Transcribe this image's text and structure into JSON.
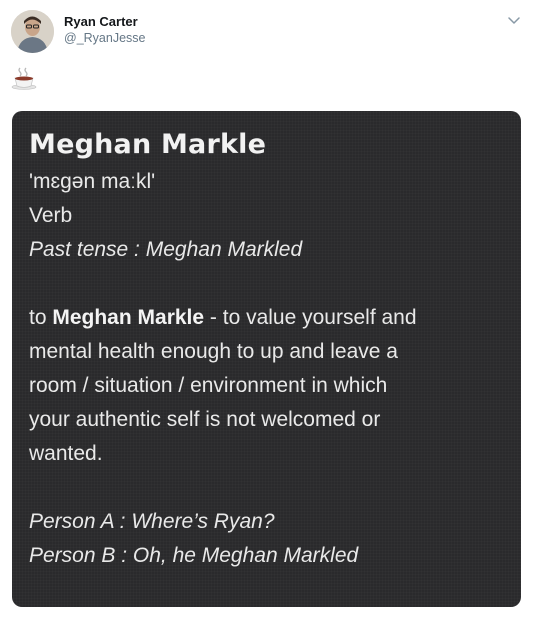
{
  "user": {
    "display_name": "Ryan Carter",
    "handle": "@_RyanJesse"
  },
  "icons": {
    "menu": "chevron-down-icon",
    "emoji": "hot-beverage-emoji"
  },
  "card": {
    "word": "Meghan Markle",
    "pronunciation": "'mɛgən maːkl'",
    "part_of_speech": "Verb",
    "past_tense": "Past tense : Meghan Markled",
    "definition_prefix": "to ",
    "definition_term": "Meghan Markle",
    "definition_line1_rest": " - to value yourself and",
    "definition_line2": "mental health enough to up and leave a",
    "definition_line3": "room / situation / environment in which",
    "definition_line4": "your authentic self is not welcomed or",
    "definition_line5": "wanted.",
    "example_a": "Person A : Where’s Ryan?",
    "example_b": "Person B :  Oh, he Meghan Markled"
  },
  "colors": {
    "card_background": "#2a2a2c",
    "card_text": "#e9e9e9",
    "handle": "#657786"
  }
}
